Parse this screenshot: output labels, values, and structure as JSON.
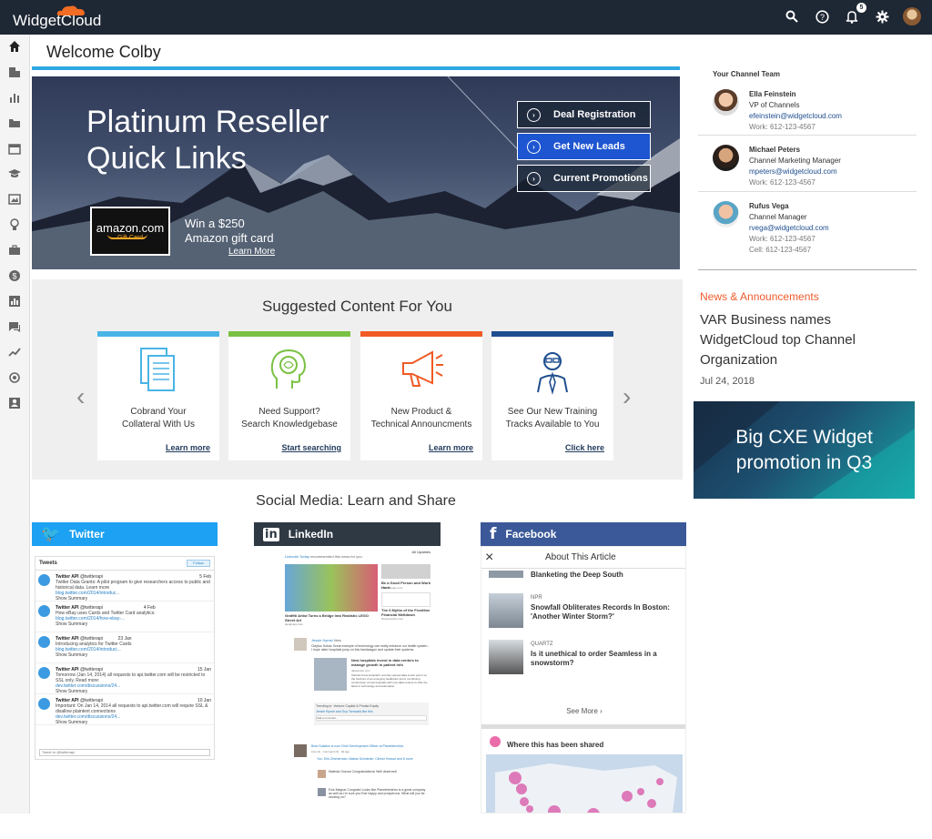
{
  "app": {
    "name": "WidgetCloud",
    "notification_count": "5"
  },
  "top_icons": [
    "search-icon",
    "help-icon",
    "bell-icon",
    "gear-icon",
    "avatar"
  ],
  "sidebar": [
    "home-icon",
    "buildings-icon",
    "bar-chart-icon",
    "folder-icon",
    "calendar-icon",
    "graduation-cap-icon",
    "image-icon",
    "lightbulb-icon",
    "briefcase-icon",
    "dollar-icon",
    "report-icon",
    "chat-icon",
    "trend-icon",
    "target-icon",
    "contact-card-icon"
  ],
  "welcome": "Welcome Colby",
  "hero": {
    "title_line1": "Platinum Reseller",
    "title_line2": "Quick Links",
    "amazon_logo": "amazon.com",
    "amazon_sub": "Gift Card",
    "win_line1": "Win a $250",
    "win_line2": "Amazon gift card",
    "learn_more": "Learn More",
    "buttons": [
      "Deal Registration",
      "Get New Leads",
      "Current Promotions"
    ]
  },
  "suggested": {
    "title": "Suggested Content For You",
    "cards": [
      {
        "line1": "Cobrand Your",
        "line2": "Collateral With Us",
        "link": "Learn more",
        "color": "#4ab4e6"
      },
      {
        "line1": "Need Support?",
        "line2": "Search Knowledgebase",
        "link": "Start searching",
        "color": "#7ac143"
      },
      {
        "line1": "New Product &",
        "line2": "Technical Announcments",
        "link": "Learn more",
        "color": "#f15a24"
      },
      {
        "line1": "See Our New Training",
        "line2": "Tracks Available to You",
        "link": "Click here",
        "color": "#1f4e8f"
      }
    ]
  },
  "social": {
    "title": "Social Media: Learn and Share",
    "twitter": {
      "label": "Twitter",
      "tweets_title": "Tweets",
      "follow": "Follow",
      "input": "Tweet to @twitterapi",
      "items": [
        {
          "name": "Twitter API",
          "handle": "@twitterapi",
          "date": "5 Feb",
          "text": "Twitter Data Grants: A pilot program to give researchers access to public and historical data. Learn more",
          "link": "blog.twitter.com/2014/introduc...",
          "summary": "Show Summary"
        },
        {
          "name": "Twitter API",
          "handle": "@twitterapi",
          "date": "4 Feb",
          "text": "How eBay uses Cards and Twitter Card analytics:",
          "link": "blog.twitter.com/2014/how-ebay-...",
          "summary": "Show Summary"
        },
        {
          "name": "Twitter API",
          "handle": "@twitterapi",
          "date": "23 Jan",
          "text": "Introducing analytics for Twitter Cards",
          "link": "blog.twitter.com/2014/introduci...",
          "summary": "Show Summary"
        },
        {
          "name": "Twitter API",
          "handle": "@twitterapi",
          "date": "15 Jan",
          "text": "Tomorrow (Jan 14, 2014) all requests to api.twitter.com will be restricted to SSL only. Read more:",
          "link": "dev.twitter.com/discussions/24...",
          "summary": "Show Summary"
        },
        {
          "name": "Twitter API",
          "handle": "@twitterapi",
          "date": "10 Jan",
          "text": "Important: On Jan 14, 2014 all requests to api.twitter.com will require SSL & disallow plaintext connections",
          "link": "dev.twitter.com/discussions/24...",
          "summary": "Show Summary"
        }
      ]
    },
    "linkedin": {
      "label": "LinkedIn",
      "updates": "All Updates",
      "source": "LinkedIn Today",
      "source_suffix": "recommended this news for you",
      "article1": "Graffiti Artist Turns a Bridge Into Realistic LEGO Street Art",
      "article1_src": "designtaxi.com",
      "article2": "Be a Good Person and Work Hard",
      "article2_src": "onlinedesign.com",
      "article3": "The 6 Myths of the Frontline Financial Meltdown",
      "article3_src": "finance.bizfm.com",
      "poster": "Jessie Hymel",
      "poster_action": "likes",
      "poster_text": "Clayton Sobav Great example of technology can really enhance our health system - I hope older hospitals jump on this bandwagon and update their systems.",
      "story": "New hospitals invest in data centers to manage growth in patient info",
      "story_src": "datacenter.com",
      "story_text": "Clinical Cross Hospital's recently opened data center puts it on the forefront of an emerging healthcare trend. Combining construction of new hospitals with new data centers to offer the latest in technology and automation.",
      "trending": "Trending in: Venture Capital & Private Equity",
      "comment": "Jessie Hymel and Guy Tarnwald like this",
      "add_comment": "Add a comment...",
      "post2": "Brad Solaitos is now Chief Development Officer at Planetelectrics",
      "post2_meta": "Like (4) · Comment (3) · 4d ago",
      "reply1": "Yoo, Erik Zimmerman, Matias Schnieder, Clinton Kessar and 8 more",
      "reply2": "Malinda Gravan Congratulations! Well deserved!",
      "reply3": "Evis Magnar Congrats! Looks like Planetelectrics is a great company as well as I'm sure you'll be happy and prosperous. What will you be working on?"
    },
    "facebook": {
      "label": "Facebook",
      "header": "About This Article",
      "item0": "Blanketing the Deep South",
      "items": [
        {
          "source": "NPR",
          "headline": "Snowfall Obliterates Records In Boston: 'Another Winter Storm?'"
        },
        {
          "source": "QUARTZ",
          "headline": "Is it unethical to order Seamless in a snowstorm?"
        }
      ],
      "see_more": "See More",
      "map_title": "Where this has been shared"
    }
  },
  "channel_team": {
    "title": "Your Channel Team",
    "members": [
      {
        "name": "Ella Feinstein",
        "role": "VP of Channels",
        "email": "efeinstein@widgetcloud.com",
        "work": "Work: 612-123-4567",
        "cell": ""
      },
      {
        "name": "Michael Peters",
        "role": "Channel Marketing Manager",
        "email": "mpeters@widgetcloud.com",
        "work": "Work: 612-123-4567",
        "cell": ""
      },
      {
        "name": "Rufus Vega",
        "role": "Channel Manager",
        "email": "rvega@widgetcloud.com",
        "work": "Work: 612-123-4567",
        "cell": "Cell: 612-123-4567"
      }
    ]
  },
  "news": {
    "label": "News & Announcements",
    "headline": "VAR Business names WidgetCloud top Channel Organization",
    "date": "Jul 24, 2018"
  },
  "promo": {
    "line1": "Big CXE Widget",
    "line2": "promotion in Q3"
  },
  "colors": {
    "topbar": "#1e2734",
    "accent_blue": "#2ea9e3",
    "twitter": "#1da1f2",
    "linkedin": "#2f3944",
    "facebook": "#3b5998",
    "news_orange": "#ef5b2d"
  }
}
